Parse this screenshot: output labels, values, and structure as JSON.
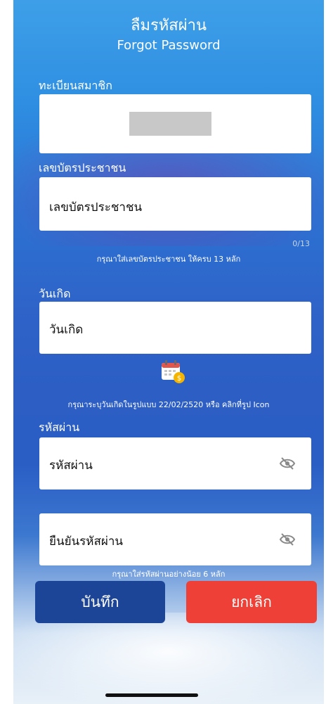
{
  "header": {
    "title_th": "ลืมรหัสผ่าน",
    "title_en": "Forgot Password"
  },
  "member_id": {
    "label": "ทะเบียนสมาชิก"
  },
  "citizen_id": {
    "label": "เลขบัตรประชาชน",
    "placeholder": "เลขบัตรประชาชน",
    "counter": "0/13",
    "hint": "กรุณาใส่เลขบัตรประชาชน ให้ครบ 13 หลัก"
  },
  "birthdate": {
    "label": "วันเกิด",
    "placeholder": "วันเกิด",
    "hint": "กรุณาระบุวันเกิดในรูปแบบ  22/02/2520 หรือ คลิกที่รูป Icon"
  },
  "password": {
    "label": "รหัสผ่าน",
    "placeholder": "รหัสผ่าน"
  },
  "confirm_password": {
    "placeholder": "ยืนยันรหัสผ่าน",
    "hint": "กรุณาใส่รหัสผ่านอย่างน้อย 6 หลัก"
  },
  "buttons": {
    "save": "บันทึก",
    "cancel": "ยกเลิก"
  },
  "colors": {
    "save_button": "#1d4597",
    "cancel_button": "#ee4036"
  }
}
